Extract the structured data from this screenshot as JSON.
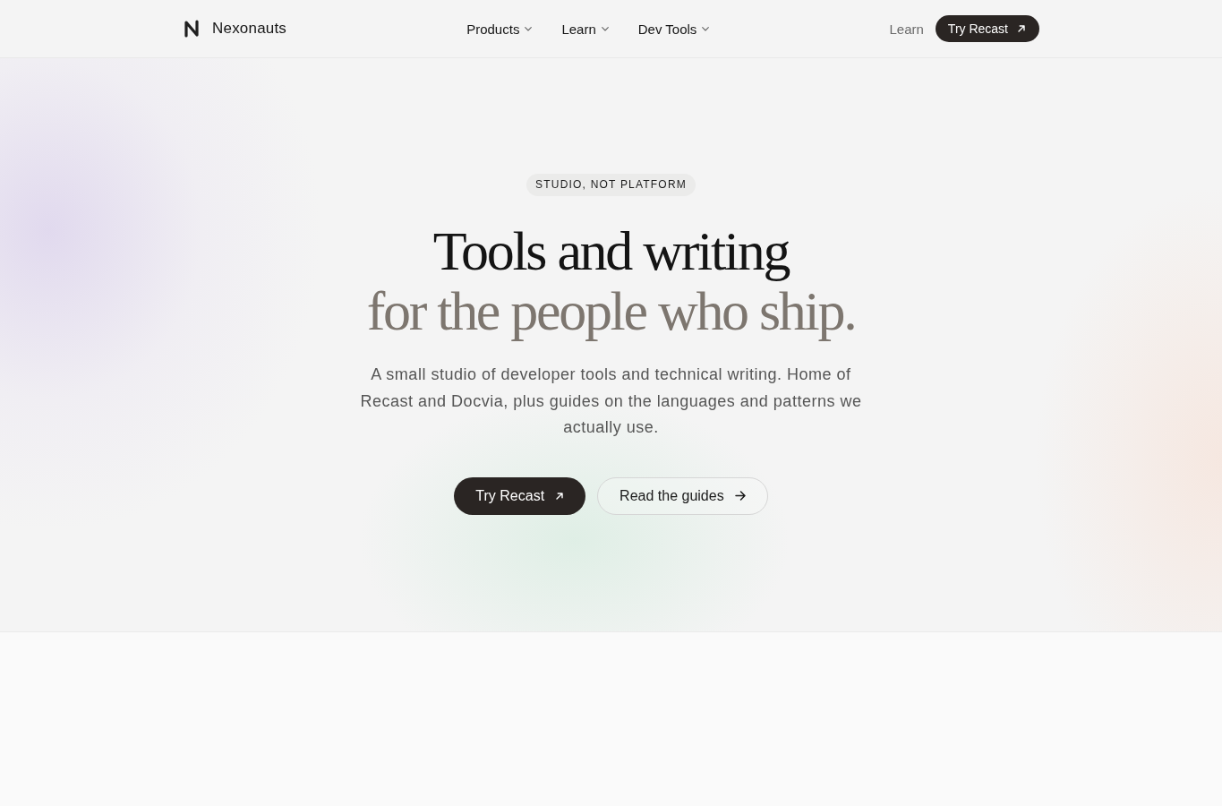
{
  "header": {
    "brand": "Nexonauts",
    "nav": [
      {
        "label": "Products",
        "dropdown": true
      },
      {
        "label": "Learn",
        "dropdown": true
      },
      {
        "label": "Dev Tools",
        "dropdown": true
      }
    ],
    "links": [
      {
        "label": "Learn"
      }
    ],
    "cta": {
      "label": "Try Recast",
      "kind": "primary"
    }
  },
  "hero": {
    "badge": "STUDIO, NOT PLATFORM",
    "title": [
      {
        "text": "Tools and writing",
        "muted": false
      },
      {
        "text": "for the people who ship.",
        "muted": true
      }
    ],
    "lead": "A small studio of developer tools and technical writing. Home of Recast and Docvia, plus guides on the languages and patterns we actually use.",
    "actions": [
      {
        "label": "Try Recast",
        "kind": "primary"
      },
      {
        "label": "Read the guides",
        "kind": "secondary"
      }
    ]
  }
}
